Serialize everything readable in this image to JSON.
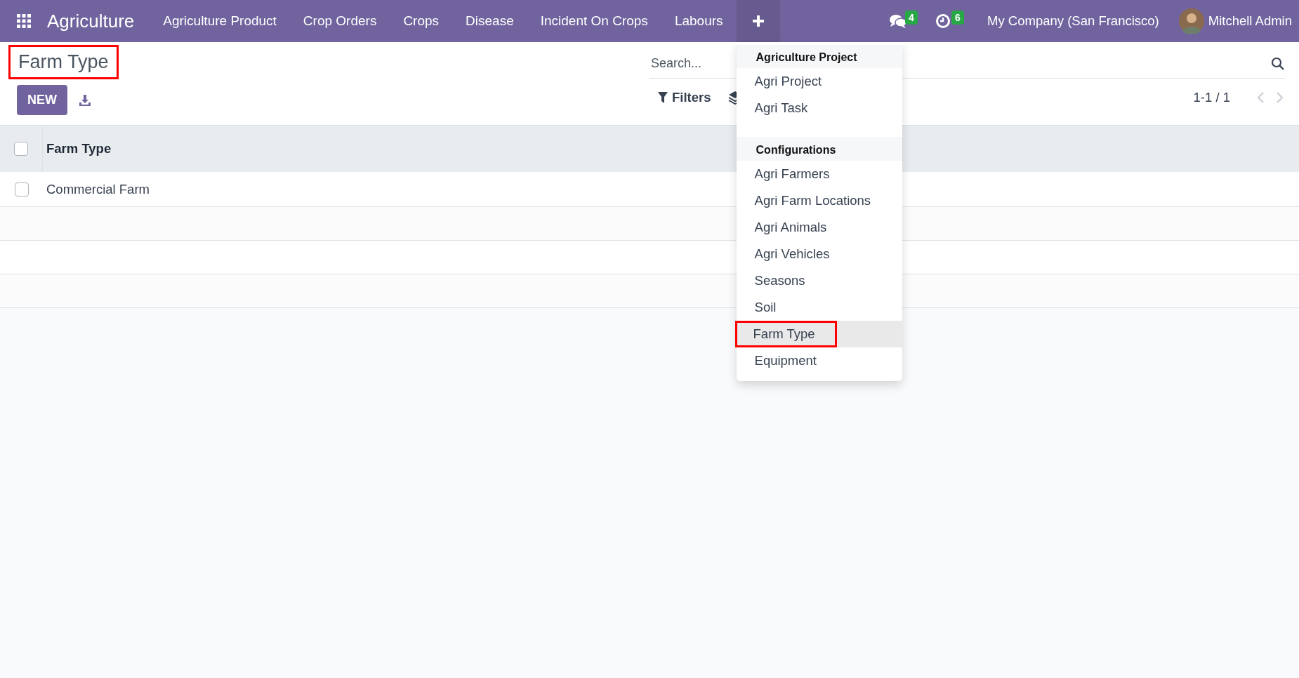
{
  "navbar": {
    "app_name": "Agriculture",
    "menus": [
      {
        "label": "Agriculture Product",
        "selected": false
      },
      {
        "label": "Crop Orders",
        "selected": false
      },
      {
        "label": "Crops",
        "selected": false
      },
      {
        "label": "Disease",
        "selected": false
      },
      {
        "label": "Incident On Crops",
        "selected": false
      },
      {
        "label": "Labours",
        "selected": false
      }
    ],
    "plus_menu": {
      "expanded": true
    },
    "messages_count": "4",
    "activities_count": "6",
    "company": "My Company (San Francisco)",
    "user": "Mitchell Admin"
  },
  "control_panel": {
    "title": "Farm Type",
    "title_highlighted": true,
    "new_button": "NEW",
    "search": {
      "placeholder": "Search..."
    },
    "filters_label": "Filters",
    "pager": "1-1 / 1"
  },
  "table": {
    "select_all_checked": false,
    "columns": [
      "Farm Type"
    ],
    "rows": [
      {
        "cells": [
          "Commercial Farm"
        ],
        "checked": false
      }
    ]
  },
  "dropdown": {
    "sections": [
      {
        "title": "Agriculture Project",
        "items": [
          {
            "label": "Agri Project",
            "selected": false,
            "highlighted": false
          },
          {
            "label": "Agri Task",
            "selected": false,
            "highlighted": false
          }
        ]
      },
      {
        "title": "Configurations",
        "items": [
          {
            "label": "Agri Farmers",
            "selected": false,
            "highlighted": false
          },
          {
            "label": "Agri Farm Locations",
            "selected": false,
            "highlighted": false
          },
          {
            "label": "Agri Animals",
            "selected": false,
            "highlighted": false
          },
          {
            "label": "Agri Vehicles",
            "selected": false,
            "highlighted": false
          },
          {
            "label": "Seasons",
            "selected": false,
            "highlighted": false
          },
          {
            "label": "Soil",
            "selected": false,
            "highlighted": false
          },
          {
            "label": "Farm Type",
            "selected": true,
            "highlighted": true
          },
          {
            "label": "Equipment",
            "selected": false,
            "highlighted": false
          }
        ]
      }
    ]
  }
}
